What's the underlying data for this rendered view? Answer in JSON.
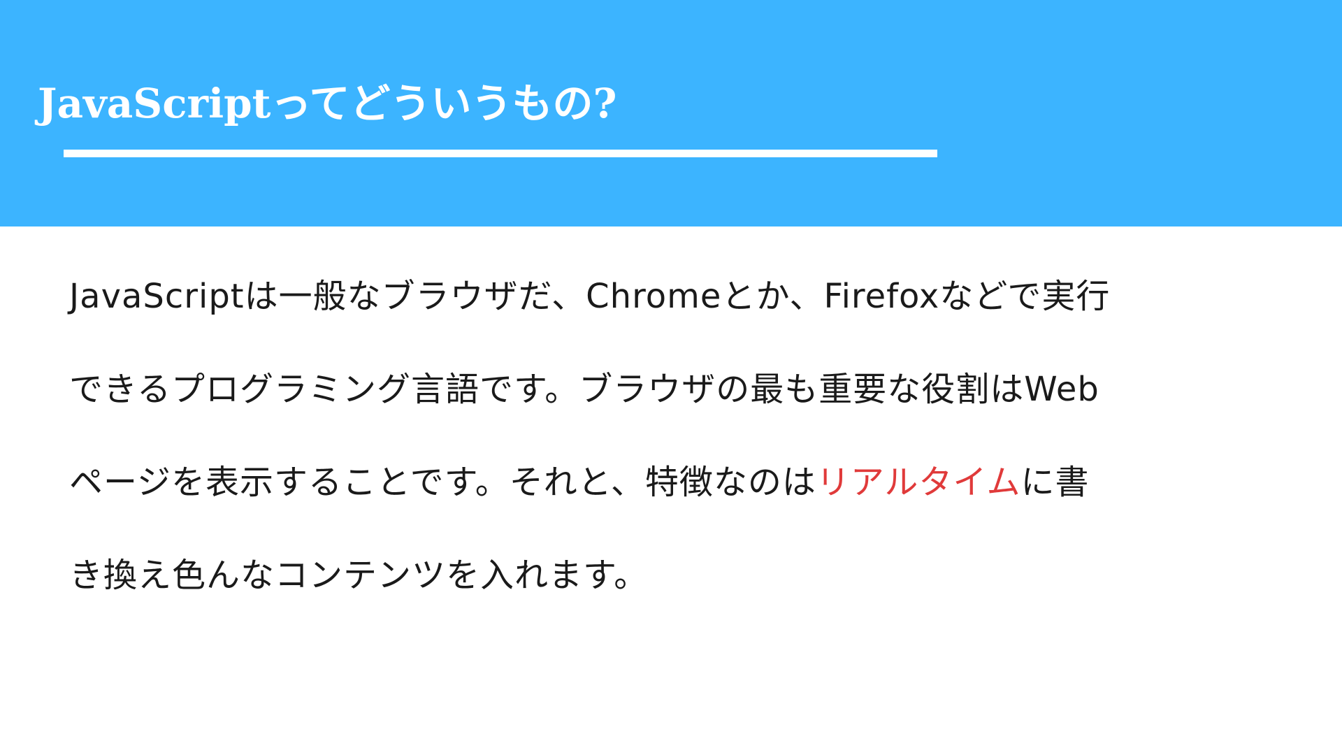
{
  "slide": {
    "title": "JavaScriptってどういうもの?",
    "body": {
      "line1": "JavaScriptは一般なブラウザだ、Chromeとか、Firefoxなどで実行",
      "line2": "できるプログラミング言語です。ブラウザの最も重要な役割はWeb",
      "line3_before": "ページを表示することです。それと、特徴なのは",
      "line3_highlight": "リアルタイム",
      "line3_after": "に書",
      "line4": "き換え色んなコンテンツを入れます。"
    },
    "colors": {
      "header_background": "#3cb4ff",
      "title_text": "#ffffff",
      "body_text": "#1a1a1a",
      "highlight_text": "#e03a3a"
    }
  }
}
